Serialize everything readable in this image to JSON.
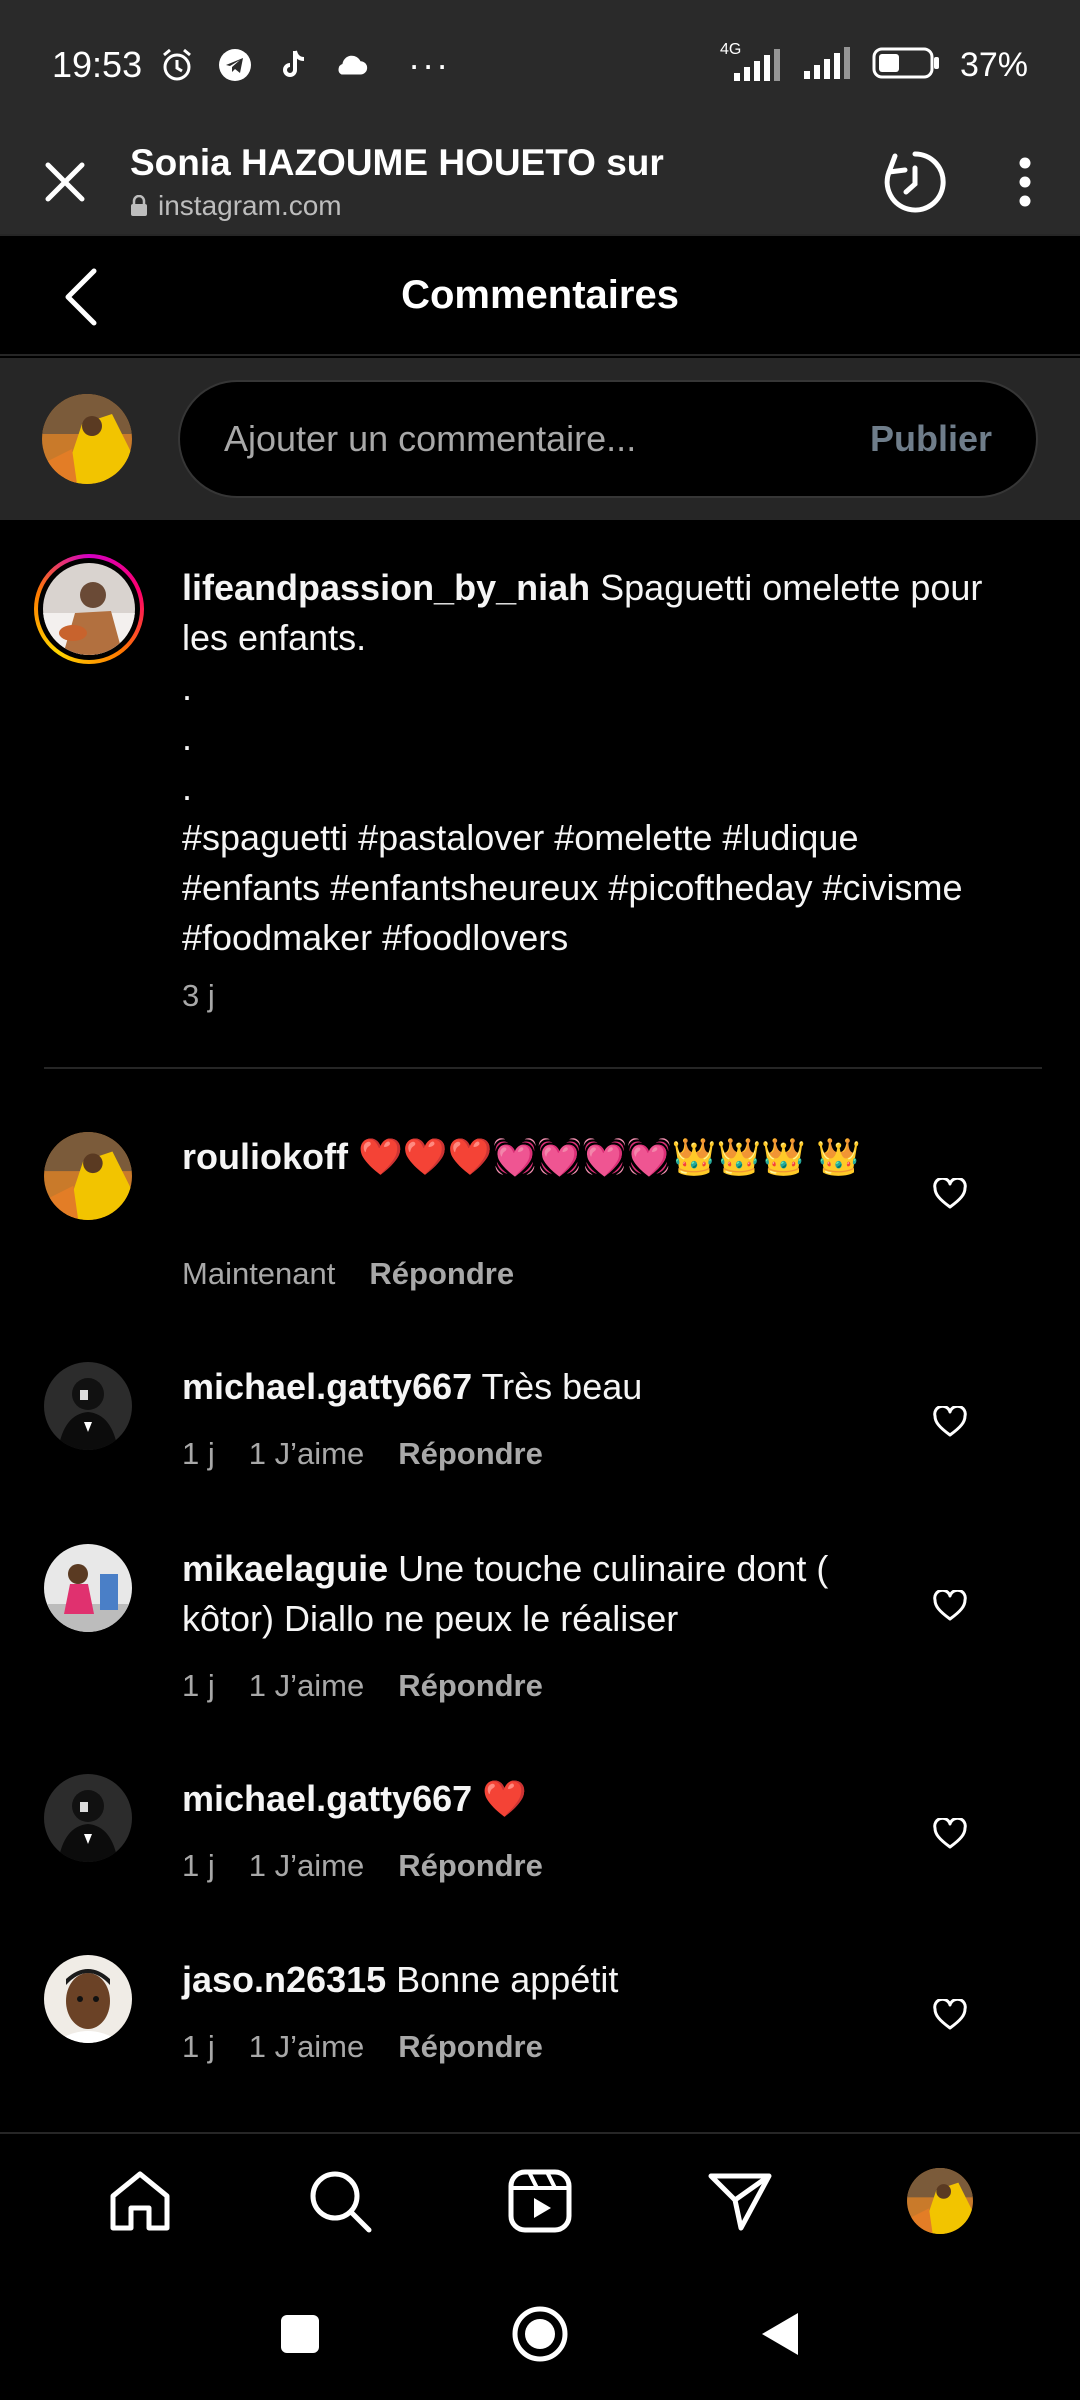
{
  "status_bar": {
    "time": "19:53",
    "more": "···",
    "network_label": "4G",
    "battery": "37%"
  },
  "browser": {
    "title": "Sonia HAZOUME HOUETO sur",
    "url": "instagram.com"
  },
  "header": {
    "title": "Commentaires"
  },
  "composer": {
    "placeholder": "Ajouter un commentaire...",
    "publish_label": "Publier"
  },
  "caption": {
    "username": "lifeandpassion_by_niah",
    "text_line1": " Spaguetti omelette pour les enfants.",
    "dots": [
      ".",
      ".",
      "."
    ],
    "hashtags": "#spaguetti #pastalover #omelette #ludique #enfants #enfantsheureux #picoftheday #civisme #foodmaker #foodlovers",
    "time": "3 j"
  },
  "comments": [
    {
      "username": "rouliokoff",
      "text": " ❤️❤️❤️💓💓💓💓👑👑👑 👑",
      "time": "Maintenant",
      "likes": "",
      "reply_label": "Répondre"
    },
    {
      "username": "michael.gatty667",
      "text": " Très beau",
      "time": "1 j",
      "likes": "1 J’aime",
      "reply_label": "Répondre"
    },
    {
      "username": "mikaelaguie",
      "text": " Une touche culinaire dont ( kôtor) Diallo ne peux le réaliser",
      "time": "1 j",
      "likes": "1 J’aime",
      "reply_label": "Répondre"
    },
    {
      "username": "michael.gatty667",
      "text": " ❤️",
      "time": "1 j",
      "likes": "1 J’aime",
      "reply_label": "Répondre"
    },
    {
      "username": "jaso.n26315",
      "text": " Bonne appétit",
      "time": "1 j",
      "likes": "1 J’aime",
      "reply_label": "Répondre"
    }
  ],
  "bottom_nav": {
    "icons": [
      "home-icon",
      "search-icon",
      "reels-icon",
      "direct-icon",
      "profile-avatar"
    ]
  },
  "colors": {
    "background": "#000000",
    "surface": "#262626",
    "muted_text": "#a8a8a8",
    "publish_disabled": "#6f7d8a",
    "heart_red": "#ff3040"
  }
}
